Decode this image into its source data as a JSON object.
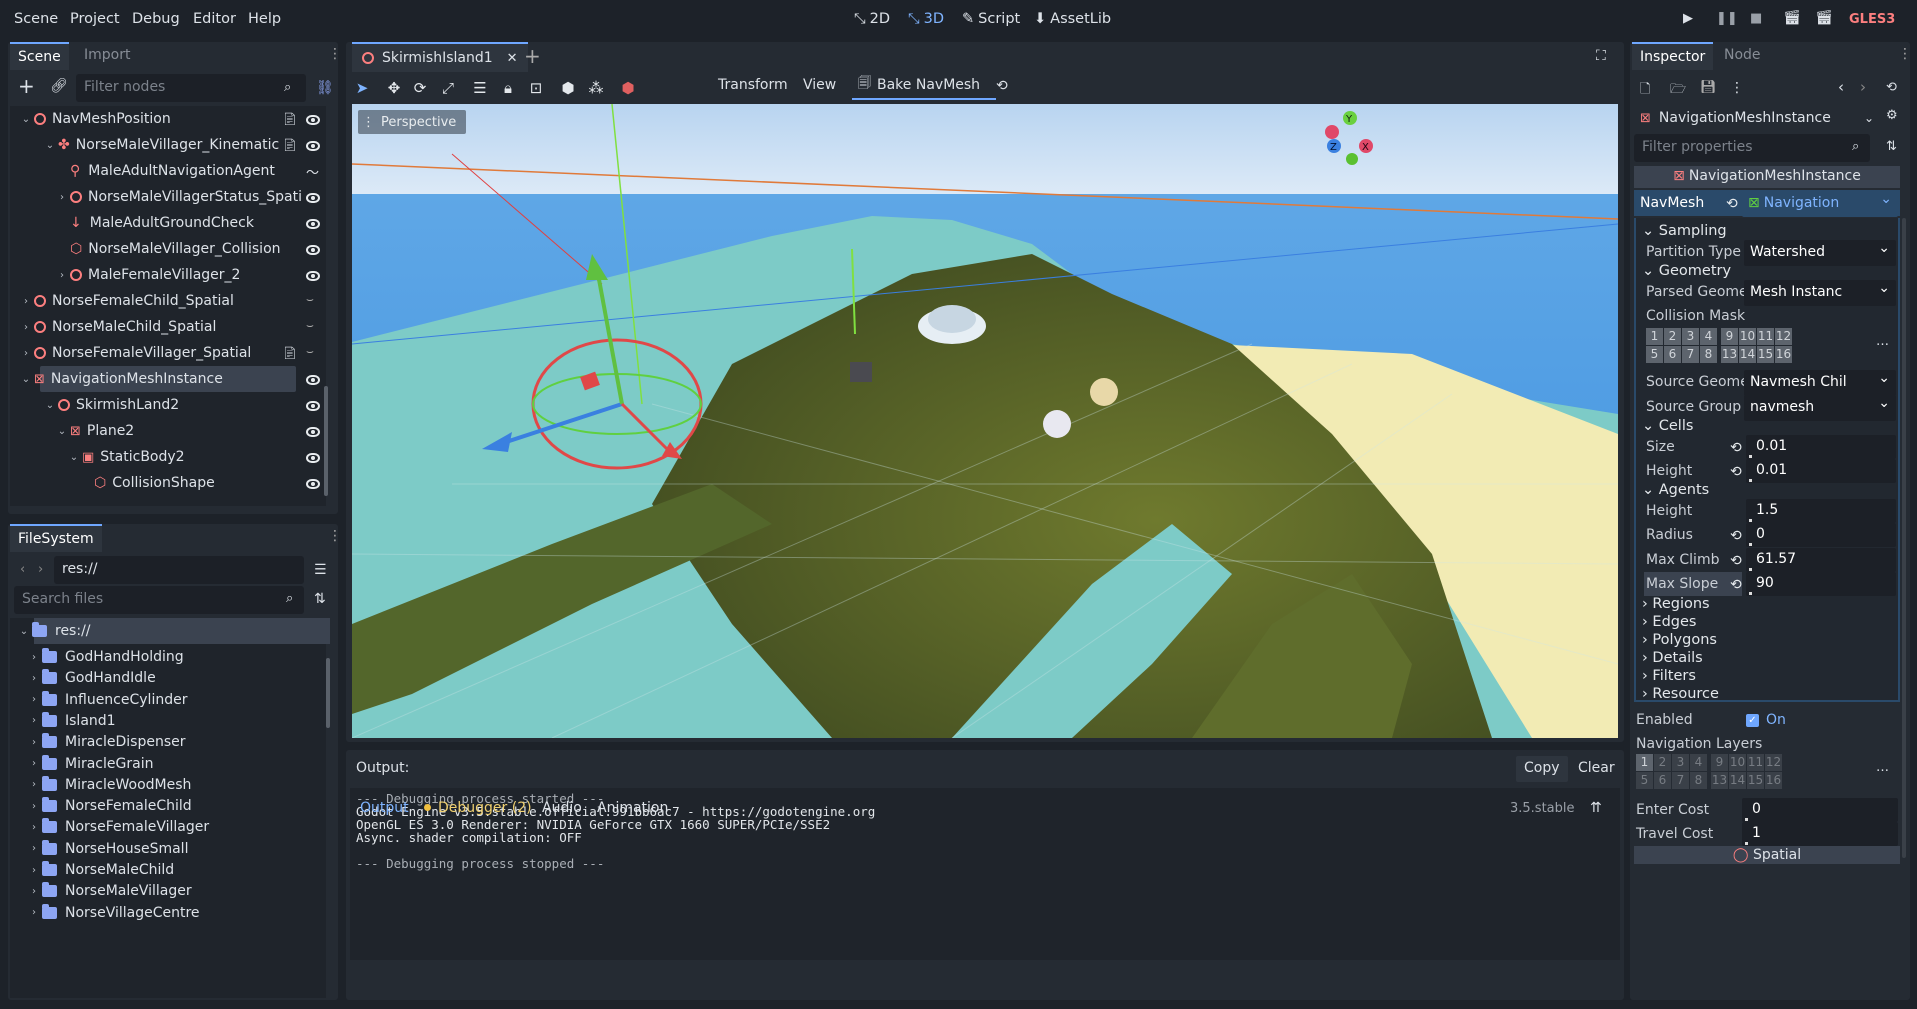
{
  "menu": [
    "Scene",
    "Project",
    "Debug",
    "Editor",
    "Help"
  ],
  "workspaces": [
    {
      "label": "2D",
      "active": false
    },
    {
      "label": "3D",
      "active": true
    },
    {
      "label": "Script",
      "active": false
    },
    {
      "label": "AssetLib",
      "active": false
    }
  ],
  "renderer": "GLES3",
  "scene_dock": {
    "tabs": [
      "Scene",
      "Import"
    ],
    "filter_placeholder": "Filter nodes",
    "nodes": [
      "NavMeshPosition",
      "NorseMaleVillager_Kinematic",
      "MaleAdultNavigationAgent",
      "NorseMaleVillagerStatus_Spati",
      "MaleAdultGroundCheck",
      "NorseMaleVillager_Collision",
      "MaleFemaleVillager_2",
      "NorseFemaleChild_Spatial",
      "NorseMaleChild_Spatial",
      "NorseFemaleVillager_Spatial",
      "NavigationMeshInstance",
      "SkirmishLand2",
      "Plane2",
      "StaticBody2",
      "CollisionShape"
    ]
  },
  "filesystem": {
    "tab": "FileSystem",
    "path": "res://",
    "search_placeholder": "Search files",
    "root": "res://",
    "folders": [
      "GodHandHolding",
      "GodHandIdle",
      "InfluenceCylinder",
      "Island1",
      "MiracleDispenser",
      "MiracleGrain",
      "MiracleWoodMesh",
      "NorseFemaleChild",
      "NorseFemaleVillager",
      "NorseHouseSmall",
      "NorseMaleChild",
      "NorseMaleVillager",
      "NorseVillageCentre"
    ]
  },
  "viewport": {
    "scene_tab": "SkirmishIsland1",
    "toolbar": {
      "transform": "Transform",
      "view": "View",
      "bake": "Bake NavMesh"
    },
    "perspective_label": "Perspective",
    "gizmo_axes": {
      "y": "Y",
      "x": "X",
      "z": "Z"
    }
  },
  "output": {
    "label": "Output:",
    "copy": "Copy",
    "clear": "Clear",
    "lines": [
      "--- Debugging process started ---",
      "Godot Engine v3.5.stable.official.991bb6ac7 - https://godotengine.org",
      "OpenGL ES 3.0 Renderer: NVIDIA GeForce GTX 1660 SUPER/PCIe/SSE2",
      "Async. shader compilation: OFF",
      "",
      "--- Debugging process stopped ---"
    ],
    "bottom_tabs": [
      "Output",
      "Debugger (2)",
      "Audio",
      "Animation"
    ],
    "version": "3.5.stable"
  },
  "inspector": {
    "tabs": [
      "Inspector",
      "Node"
    ],
    "object": "NavigationMeshInstance",
    "filter_placeholder": "Filter properties",
    "header": "NavigationMeshInstance",
    "navmesh_label": "NavMesh",
    "navmesh_value": "Navigation",
    "sections": {
      "sampling": "Sampling",
      "geometry": "Geometry",
      "cells": "Cells",
      "agents": "Agents"
    },
    "props": {
      "partition_type": {
        "label": "Partition Type",
        "value": "Watershed"
      },
      "parsed_geometry": {
        "label": "Parsed Geometry",
        "value": "Mesh Instanc"
      },
      "collision_mask": {
        "label": "Collision Mask"
      },
      "source_geometry": {
        "label": "Source Geometry",
        "value": "Navmesh Chil"
      },
      "source_group": {
        "label": "Source Group Na",
        "value": "navmesh"
      },
      "cell_size": {
        "label": "Size",
        "value": "0.01"
      },
      "cell_height": {
        "label": "Height",
        "value": "0.01"
      },
      "agent_height": {
        "label": "Height",
        "value": "1.5"
      },
      "agent_radius": {
        "label": "Radius",
        "value": "0"
      },
      "max_climb": {
        "label": "Max Climb",
        "value": "61.57"
      },
      "max_slope": {
        "label": "Max Slope",
        "value": "90"
      }
    },
    "collapsed": [
      "Regions",
      "Edges",
      "Polygons",
      "Details",
      "Filters",
      "Resource"
    ],
    "enabled": {
      "label": "Enabled",
      "value": "On"
    },
    "nav_layers": "Navigation Layers",
    "enter_cost": {
      "label": "Enter Cost",
      "value": "0"
    },
    "travel_cost": {
      "label": "Travel Cost",
      "value": "1"
    },
    "footer": "Spatial",
    "mask_row1": [
      "1",
      "2",
      "3",
      "4",
      "9",
      "10",
      "11",
      "12"
    ],
    "mask_row2": [
      "5",
      "6",
      "7",
      "8",
      "13",
      "14",
      "15",
      "16"
    ]
  },
  "colors": {
    "accent": "#6fa7ff",
    "node_red": "#fc7f7f",
    "folder": "#8da5f3",
    "bg": "#1d2229",
    "panel": "#252b33"
  }
}
